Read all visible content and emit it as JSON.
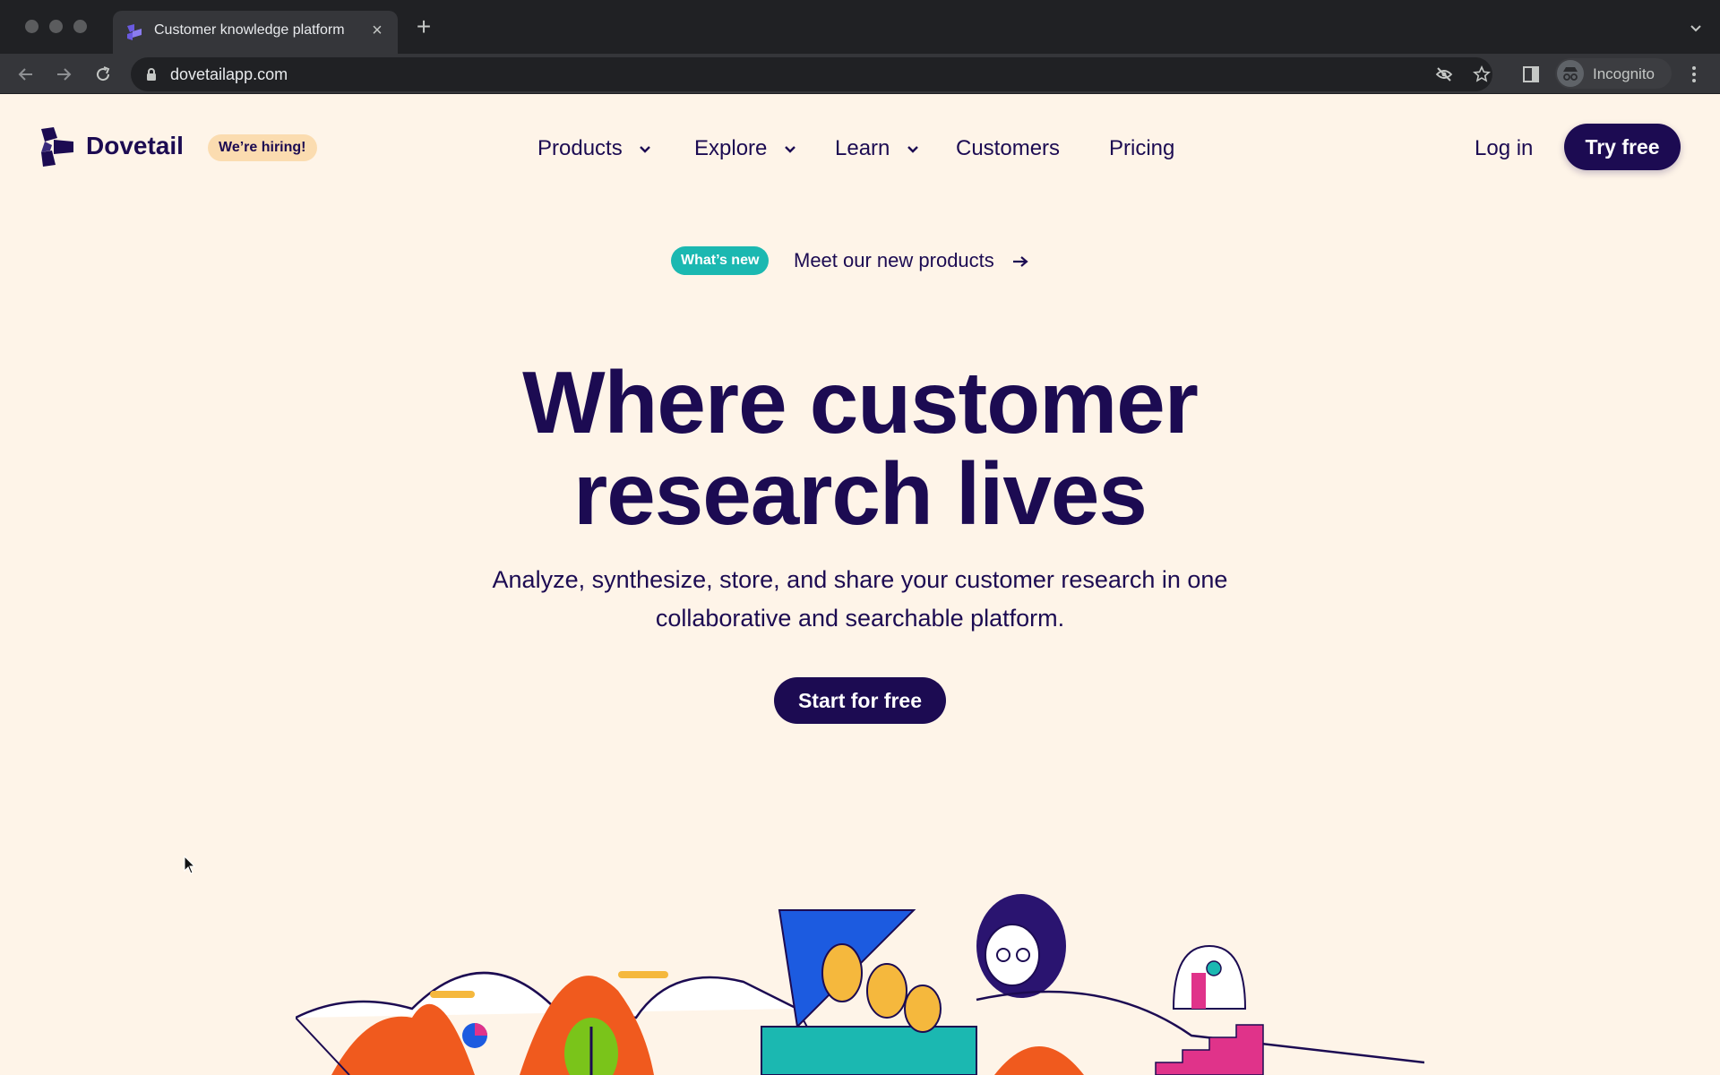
{
  "browser": {
    "tab_title": "Customer knowledge platform",
    "url": "dovetailapp.com",
    "incognito_label": "Incognito",
    "icons": [
      "back-icon",
      "forward-icon",
      "reload-icon",
      "lock-icon",
      "eye-off-icon",
      "star-icon",
      "side-panel-icon",
      "more-icon"
    ]
  },
  "header": {
    "brand": "Dovetail",
    "hiring_badge": "We’re hiring!",
    "nav": [
      {
        "label": "Products",
        "has_dropdown": true
      },
      {
        "label": "Explore",
        "has_dropdown": true
      },
      {
        "label": "Learn",
        "has_dropdown": true
      },
      {
        "label": "Customers",
        "has_dropdown": false
      },
      {
        "label": "Pricing",
        "has_dropdown": false
      }
    ],
    "login": "Log in",
    "try_free": "Try free"
  },
  "announcement": {
    "badge": "What’s new",
    "link": "Meet our new products"
  },
  "hero": {
    "title": "Where customer research lives",
    "subtitle": "Analyze, synthesize, store, and share your customer research in one collaborative and searchable platform.",
    "cta": "Start for free"
  },
  "colors": {
    "brand": "#1c0b52",
    "background": "#fef4e8",
    "teal": "#1bb8b1",
    "hiring_badge": "#fbdcb0"
  }
}
